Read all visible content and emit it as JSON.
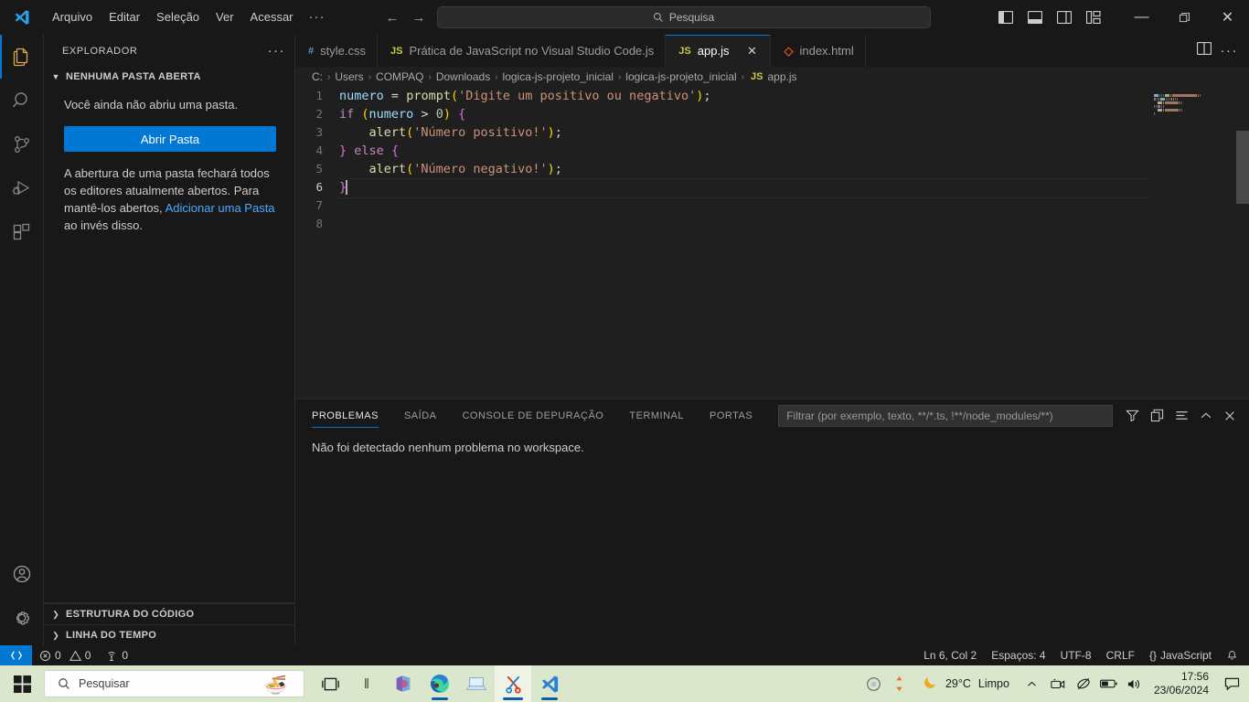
{
  "titlebar": {
    "menus": [
      "Arquivo",
      "Editar",
      "Seleção",
      "Ver",
      "Acessar"
    ],
    "more_label": "···",
    "back_icon": "back-arrow-icon",
    "forward_icon": "forward-arrow-icon",
    "search_placeholder": "Pesquisa",
    "search_icon": "search-icon",
    "minimize_label": "—",
    "maximize_label": "❐",
    "close_label": "✕"
  },
  "activitybar": {
    "items": [
      {
        "name": "explorer",
        "icon": "files-icon"
      },
      {
        "name": "search",
        "icon": "search-icon"
      },
      {
        "name": "source-control",
        "icon": "source-control-icon"
      },
      {
        "name": "run-debug",
        "icon": "run-and-debug-icon"
      },
      {
        "name": "extensions",
        "icon": "extensions-icon"
      }
    ],
    "bottom": [
      {
        "name": "accounts",
        "icon": "account-icon"
      },
      {
        "name": "settings",
        "icon": "gear-icon"
      }
    ]
  },
  "sidebar": {
    "title": "EXPLORADOR",
    "more_actions": "···",
    "section_no_folder": "NENHUMA PASTA ABERTA",
    "message": "Você ainda não abriu uma pasta.",
    "open_folder_button": "Abrir Pasta",
    "note_part1": "A abertura de uma pasta fechará todos os editores atualmente abertos. Para mantê-los abertos,",
    "note_link": "Adicionar uma Pasta",
    "note_part2": "ao invés disso.",
    "section_outline": "ESTRUTURA DO CÓDIGO",
    "section_timeline": "LINHA DO TEMPO"
  },
  "tabs": [
    {
      "label": "style.css",
      "icon": "css-file-icon",
      "icon_glyph": "#",
      "active": false,
      "closable": false
    },
    {
      "label": "Prática de JavaScript no Visual Studio Code.js",
      "icon": "js-file-icon",
      "icon_glyph": "JS",
      "active": false,
      "closable": false
    },
    {
      "label": "app.js",
      "icon": "js-file-icon",
      "icon_glyph": "JS",
      "active": true,
      "closable": true,
      "close_label": "✕"
    },
    {
      "label": "index.html",
      "icon": "html-file-icon",
      "icon_glyph": "◇",
      "active": false,
      "closable": false
    }
  ],
  "editor_actions": {
    "split_editor_icon": "split-editor-icon",
    "more_actions_label": "···"
  },
  "breadcrumb": {
    "separator": "›",
    "items": [
      "C:",
      "Users",
      "COMPAQ",
      "Downloads",
      "logica-js-projeto_inicial",
      "logica-js-projeto_inicial"
    ],
    "file": "app.js",
    "file_icon_glyph": "JS"
  },
  "code": {
    "lines": [
      {
        "n": 1,
        "tokens": [
          {
            "t": "numero",
            "c": "t-var"
          },
          {
            "t": " ",
            "c": ""
          },
          {
            "t": "=",
            "c": "t-op"
          },
          {
            "t": " ",
            "c": ""
          },
          {
            "t": "prompt",
            "c": "t-fn"
          },
          {
            "t": "(",
            "c": "t-pa"
          },
          {
            "t": "'Digite um positivo ou negativo'",
            "c": "t-str"
          },
          {
            "t": ")",
            "c": "t-pa"
          },
          {
            "t": ";",
            "c": "t-op"
          }
        ]
      },
      {
        "n": 2,
        "tokens": [
          {
            "t": "if",
            "c": "t-kw"
          },
          {
            "t": " ",
            "c": ""
          },
          {
            "t": "(",
            "c": "t-pa"
          },
          {
            "t": "numero",
            "c": "t-var"
          },
          {
            "t": " ",
            "c": ""
          },
          {
            "t": ">",
            "c": "t-op"
          },
          {
            "t": " ",
            "c": ""
          },
          {
            "t": "0",
            "c": "t-num"
          },
          {
            "t": ")",
            "c": "t-pa"
          },
          {
            "t": " ",
            "c": ""
          },
          {
            "t": "{",
            "c": "t-pb"
          }
        ]
      },
      {
        "n": 3,
        "tokens": [
          {
            "t": "    ",
            "c": "indent-guide"
          },
          {
            "t": "alert",
            "c": "t-fn"
          },
          {
            "t": "(",
            "c": "t-pa"
          },
          {
            "t": "'Número positivo!'",
            "c": "t-str"
          },
          {
            "t": ")",
            "c": "t-pa"
          },
          {
            "t": ";",
            "c": "t-op"
          }
        ]
      },
      {
        "n": 4,
        "tokens": [
          {
            "t": "}",
            "c": "t-pb"
          },
          {
            "t": " ",
            "c": ""
          },
          {
            "t": "else",
            "c": "t-kw"
          },
          {
            "t": " ",
            "c": ""
          },
          {
            "t": "{",
            "c": "t-pb"
          }
        ]
      },
      {
        "n": 5,
        "tokens": [
          {
            "t": "    ",
            "c": "indent-guide"
          },
          {
            "t": "alert",
            "c": "t-fn"
          },
          {
            "t": "(",
            "c": "t-pa"
          },
          {
            "t": "'Número negativo!'",
            "c": "t-str"
          },
          {
            "t": ")",
            "c": "t-pa"
          },
          {
            "t": ";",
            "c": "t-op"
          }
        ]
      },
      {
        "n": 6,
        "tokens": [
          {
            "t": "}",
            "c": "t-pb"
          }
        ],
        "current": true
      },
      {
        "n": 7,
        "tokens": []
      },
      {
        "n": 8,
        "tokens": []
      }
    ]
  },
  "panel": {
    "tabs": [
      "PROBLEMAS",
      "SAÍDA",
      "CONSOLE DE DEPURAÇÃO",
      "TERMINAL",
      "PORTAS"
    ],
    "active_tab": "PROBLEMAS",
    "filter_placeholder": "Filtrar (por exemplo, texto, **/*.ts, !**/node_modules/**)",
    "message": "Não foi detectado nenhum problema no workspace.",
    "actions": [
      {
        "name": "filter-icon",
        "label": "filter"
      },
      {
        "name": "collapse-all-icon",
        "label": "collapse"
      },
      {
        "name": "view-as-list-icon",
        "label": "list"
      },
      {
        "name": "maximize-panel-icon",
        "label": "^"
      },
      {
        "name": "close-panel-icon",
        "label": "✕"
      }
    ]
  },
  "statusbar": {
    "remote_icon": "remote-window-icon",
    "errors": "0",
    "warnings": "0",
    "ports": "0",
    "cursor_position": "Ln 6, Col 2",
    "indentation": "Espaços: 4",
    "encoding": "UTF-8",
    "eol": "CRLF",
    "language": "JavaScript",
    "language_icon": "{}",
    "bell_icon": "notifications-bell-icon"
  },
  "taskbar": {
    "start_icon": "windows-start-icon",
    "search_placeholder": "Pesquisar",
    "search_icon": "search-icon",
    "food_icon": "🍜",
    "items": [
      {
        "name": "task-view-icon",
        "glyph": "task-view"
      },
      {
        "name": "widgets-separator",
        "glyph": "‖"
      },
      {
        "name": "microsoft-365-icon",
        "glyph": "m365"
      },
      {
        "name": "microsoft-edge-icon",
        "glyph": "edge"
      },
      {
        "name": "file-explorer-icon",
        "glyph": "explorer"
      },
      {
        "name": "snipping-tool-icon",
        "glyph": "snip"
      },
      {
        "name": "vscode-icon",
        "glyph": "vscode"
      }
    ],
    "tray": {
      "media_icon": "media-player-icon",
      "updates_icon": "updates-arrows-icon",
      "weather_icon": "moon-icon",
      "temperature": "29°C",
      "condition": "Limpo",
      "chevron": "⌃",
      "camera_icon": "camera-icon",
      "no_network_icon": "network-off-icon",
      "battery_icon": "battery-icon",
      "volume_icon": "volume-icon",
      "time": "17:56",
      "date": "23/06/2024",
      "notification_icon": "notification-icon"
    }
  },
  "colors": {
    "accent": "#0078d4",
    "titlebar_bg": "#181818",
    "editor_bg": "#1f1f1f",
    "taskbar_bg": "#dbe7cd"
  }
}
